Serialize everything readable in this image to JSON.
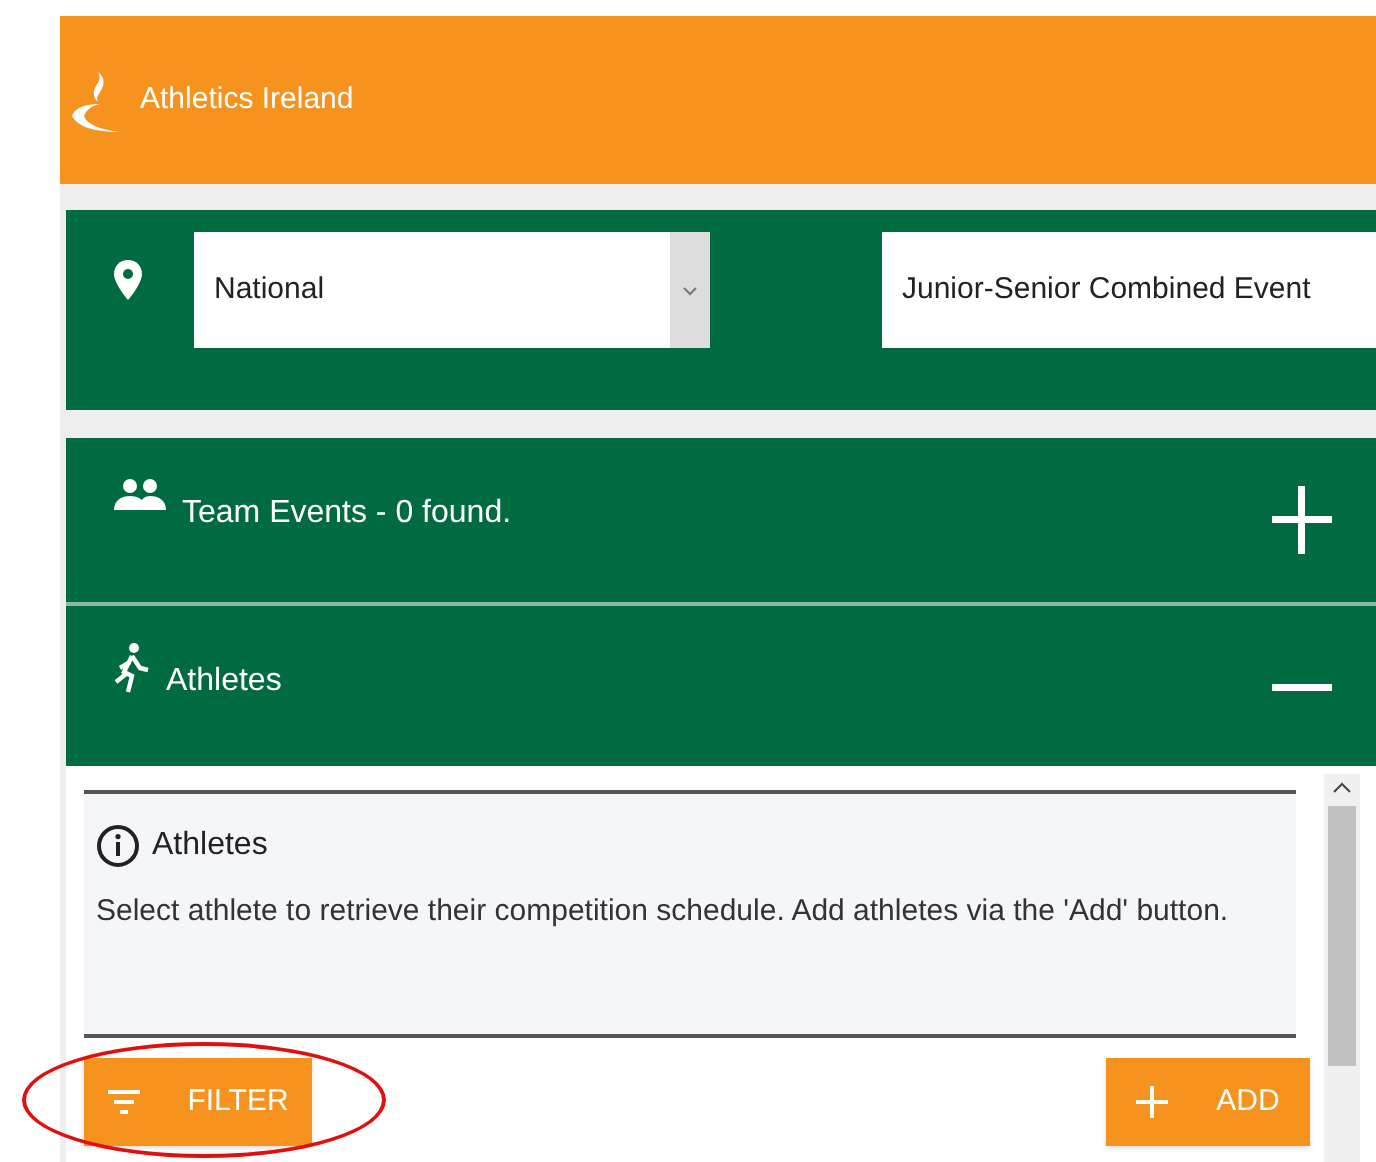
{
  "header": {
    "logo_text": "Athletics Ireland"
  },
  "filters": [
    {
      "kind": "select",
      "value": "National"
    },
    {
      "kind": "text",
      "value": "Junior-Senior Combined Event"
    }
  ],
  "sections": [
    {
      "kind": "team",
      "title": "Team Events - 0 found.",
      "expanded": false
    },
    {
      "kind": "athlete",
      "title": "Athletes",
      "expanded": true
    }
  ],
  "info": {
    "title": "Athletes",
    "text": "Select athlete to retrieve their competition schedule. Add athletes via the 'Add' button."
  },
  "buttons": [
    {
      "kind": "filter",
      "label": "FILTER",
      "highlighted": true
    },
    {
      "kind": "add",
      "label": "ADD",
      "highlighted": false
    }
  ]
}
